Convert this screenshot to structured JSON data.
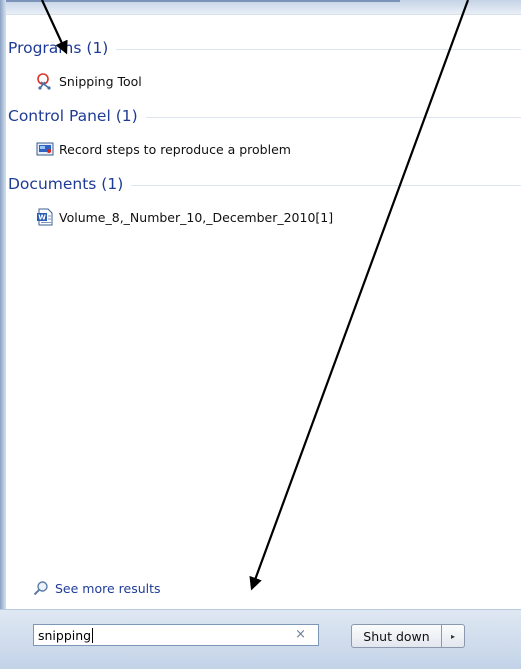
{
  "groups": [
    {
      "title": "Programs (1)",
      "items": [
        {
          "label": "Snipping Tool",
          "icon": "scissors-icon"
        }
      ]
    },
    {
      "title": "Control Panel (1)",
      "items": [
        {
          "label": "Record steps to reproduce a problem",
          "icon": "record-steps-icon"
        }
      ]
    },
    {
      "title": "Documents (1)",
      "items": [
        {
          "label": "Volume_8,_Number_10,_December_2010[1]",
          "icon": "word-document-icon"
        }
      ]
    }
  ],
  "see_more": {
    "label": "See more results",
    "icon": "magnifier-icon"
  },
  "search": {
    "value": "snipping",
    "clear_glyph": "×"
  },
  "shutdown": {
    "label": "Shut down",
    "arrow_glyph": "▸"
  },
  "annotations": {
    "arrow_color": "#000000",
    "icon": "arrow-icon"
  },
  "colors": {
    "group_title": "#1e3c96",
    "link": "#1e3c96"
  }
}
